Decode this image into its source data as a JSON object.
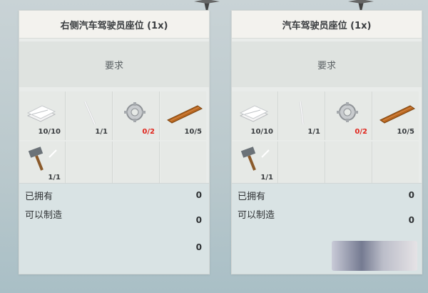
{
  "panels": [
    {
      "title": "右侧汽车驾驶员座位 (1x)",
      "require_label": "要求",
      "items": [
        {
          "icon": "paper-stack-icon",
          "count": "10/10",
          "short": false
        },
        {
          "icon": "nail-icon",
          "count": "1/1",
          "short": false
        },
        {
          "icon": "gear-part-icon",
          "count": "0/2",
          "short": true
        },
        {
          "icon": "wood-plank-icon",
          "count": "10/5",
          "short": false
        },
        {
          "icon": "hammer-icon",
          "count": "1/1",
          "short": false
        }
      ],
      "owned_label": "已拥有",
      "owned_value": "0",
      "craftable_label": "可以制造",
      "craftable_value": "0",
      "extra_value": "0"
    },
    {
      "title": "汽车驾驶员座位 (1x)",
      "require_label": "要求",
      "items": [
        {
          "icon": "paper-stack-icon",
          "count": "10/10",
          "short": false
        },
        {
          "icon": "nail-icon",
          "count": "1/1",
          "short": false
        },
        {
          "icon": "gear-part-icon",
          "count": "0/2",
          "short": true
        },
        {
          "icon": "wood-plank-icon",
          "count": "10/5",
          "short": false
        },
        {
          "icon": "hammer-icon",
          "count": "1/1",
          "short": false
        }
      ],
      "owned_label": "已拥有",
      "owned_value": "0",
      "craftable_label": "可以制造",
      "craftable_value": "0"
    }
  ],
  "colors": {
    "count_normal": "#3a3d40",
    "count_short": "#e0241b"
  }
}
